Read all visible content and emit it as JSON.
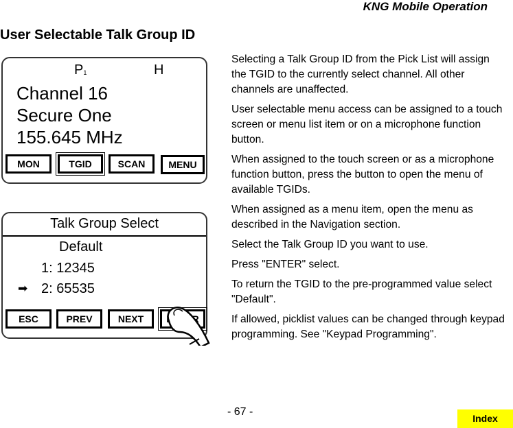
{
  "header": {
    "section": "KNG Mobile Operation"
  },
  "page_title": "User Selectable Talk Group ID",
  "screen1": {
    "status_p": "P",
    "status_p_sub": "1",
    "status_h": "H",
    "lines": [
      "Channel 16",
      "Secure One",
      "155.645 MHz"
    ],
    "buttons": [
      {
        "label": "MON",
        "selected": false
      },
      {
        "label": "TGID",
        "selected": true
      },
      {
        "label": "SCAN",
        "selected": false
      },
      {
        "label": "MENU",
        "selected": false
      }
    ]
  },
  "screen2": {
    "title": "Talk Group Select",
    "items": [
      "Default",
      "1: 12345",
      "2: 65535"
    ],
    "selected_index": 2,
    "selection_arrow": "➡",
    "buttons": [
      {
        "label": "ESC",
        "selected": false
      },
      {
        "label": "PREV",
        "selected": false
      },
      {
        "label": "NEXT",
        "selected": false
      },
      {
        "label": "ENTER",
        "selected": true
      }
    ]
  },
  "paragraphs": [
    "Selecting a Talk Group ID from the Pick List will assign the TGID to the currently select channel. All other channels are unaffected.",
    "User selectable menu access can be assigned to a touch screen or menu list item or on a microphone function button.",
    "When assigned to the touch screen or as a microphone function button, press the button to open the menu of available TGIDs.",
    "When assigned as a menu item, open the menu as described in the Navigation section.",
    "Select the Talk Group ID you want to use.",
    "Press \"ENTER\" select.",
    "To return the TGID to the pre-programmed value select \"Default\".",
    "If allowed, picklist values can be changed through keypad programming. See \"Keypad Programming\"."
  ],
  "footer": {
    "page_number": "- 67 -",
    "index_label": "Index",
    "index_color": "#ffff00"
  }
}
